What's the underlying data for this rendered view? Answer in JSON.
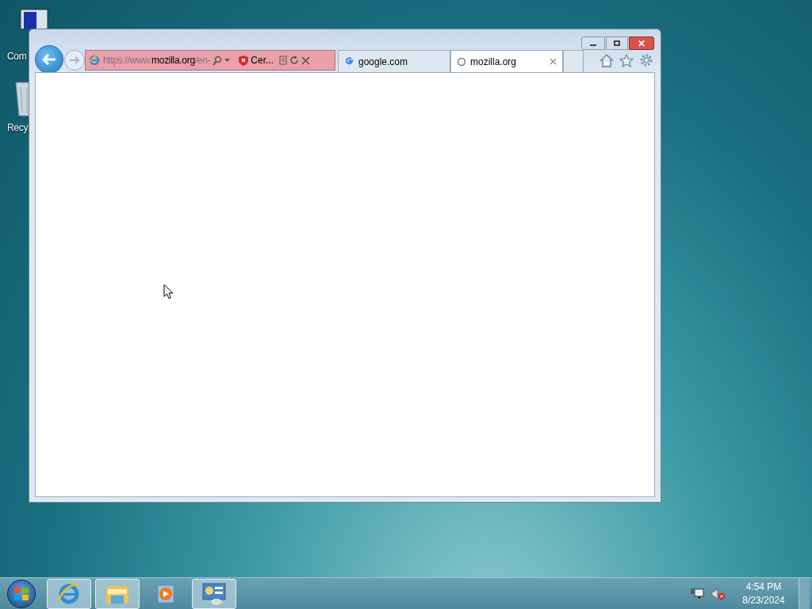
{
  "desktop_icons": [
    {
      "kind": "computer",
      "label": "Com"
    },
    {
      "kind": "recycle",
      "label": "Recy"
    }
  ],
  "browser": {
    "url": {
      "prefix": "https://www.",
      "domain": "mozilla.org",
      "suffix": "/en-"
    },
    "certificate": "Cer...",
    "tabs": [
      {
        "label": "google.com",
        "kind": "google",
        "selected": false
      },
      {
        "label": "mozilla.org",
        "kind": "loading",
        "selected": true
      }
    ]
  },
  "window_close": "✕",
  "taskbar": {
    "apps": [
      {
        "kind": "ie",
        "running": true
      },
      {
        "kind": "folder",
        "running": true
      },
      {
        "kind": "media",
        "running": false
      },
      {
        "kind": "panel",
        "running": true
      }
    ],
    "time": "4:54 PM",
    "date": "8/23/2024"
  }
}
